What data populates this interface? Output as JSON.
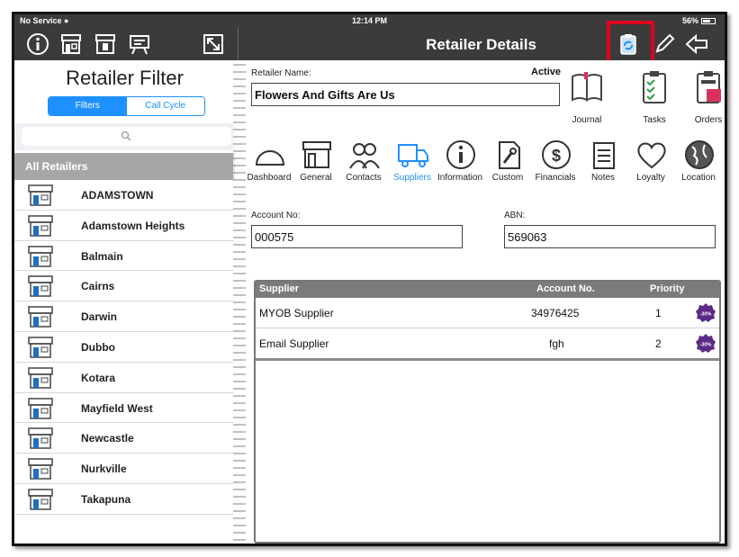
{
  "status_bar": {
    "carrier": "No Service",
    "time": "12:14 PM",
    "battery": "56%"
  },
  "toolbar": {
    "title": "Retailer Details"
  },
  "left_panel": {
    "title": "Retailer Filter",
    "segments": [
      "Filters",
      "Call Cycle"
    ],
    "selected_segment": "Filters",
    "list_header": "All Retailers",
    "retailers": [
      "ADAMSTOWN",
      "Adamstown Heights",
      "Balmain",
      "Cairns",
      "Darwin",
      "Dubbo",
      "Kotara",
      "Mayfield West",
      "Newcastle",
      "Nurkville",
      "Takapuna"
    ]
  },
  "details": {
    "retailer_name_label": "Retailer Name:",
    "retailer_name": "Flowers And Gifts Are Us",
    "status": "Active",
    "top_actions": [
      "Journal",
      "Tasks",
      "Orders"
    ],
    "tabs": [
      "Dashboard",
      "General",
      "Contacts",
      "Suppliers",
      "Information",
      "Custom",
      "Financials",
      "Notes",
      "Loyalty",
      "Location"
    ],
    "selected_tab": "Suppliers",
    "account_no_label": "Account No:",
    "account_no": "000575",
    "abn_label": "ABN:",
    "abn": "569063"
  },
  "suppliers_table": {
    "columns": [
      "Supplier",
      "Account No.",
      "Priority"
    ],
    "rows": [
      {
        "supplier": "MYOB Supplier",
        "account_no": "34976425",
        "priority": "1",
        "discount": "-30%"
      },
      {
        "supplier": "Email Supplier",
        "account_no": "fgh",
        "priority": "2",
        "discount": "-30%"
      }
    ]
  },
  "colors": {
    "accent": "#1e90ff",
    "toolbar": "#3b3b3b",
    "highlight": "#e0001b",
    "badge": "#5b2a86"
  }
}
